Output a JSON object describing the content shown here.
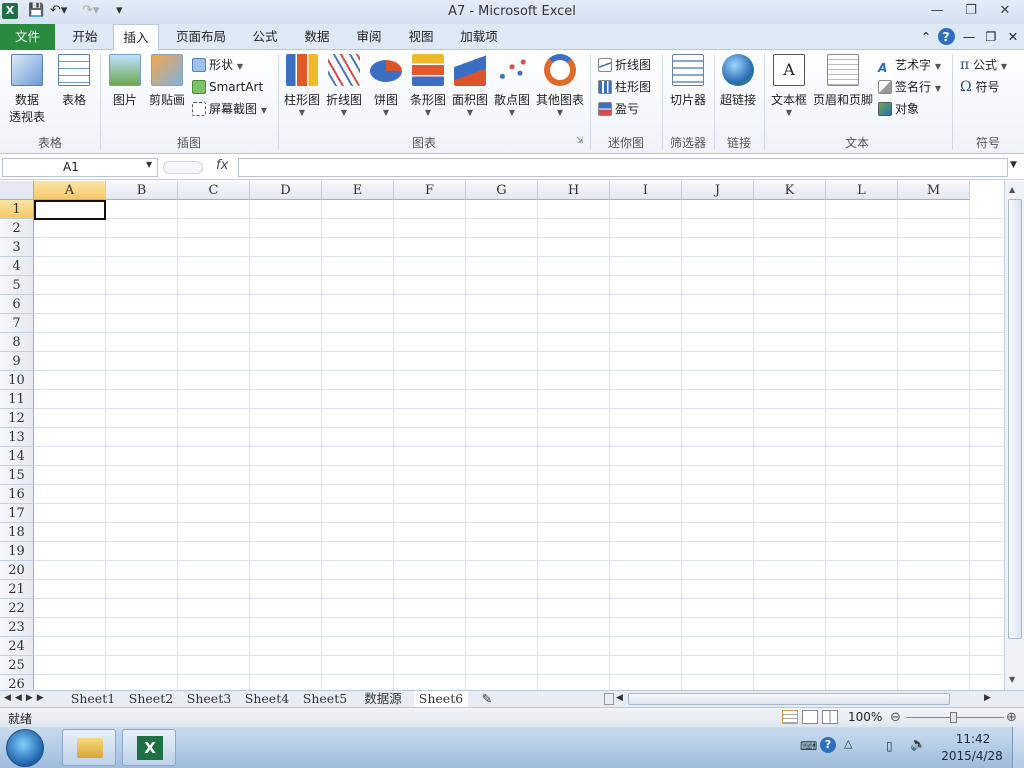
{
  "window": {
    "title": "A7  -  Microsoft Excel"
  },
  "tabs": [
    "文件",
    "开始",
    "插入",
    "页面布局",
    "公式",
    "数据",
    "审阅",
    "视图",
    "加载项"
  ],
  "active_tab": "插入",
  "ribbon": {
    "tables": {
      "pivot_label_1": "数据",
      "pivot_label_2": "透视表",
      "table_label": "表格",
      "group": "表格"
    },
    "illustrations": {
      "picture": "图片",
      "clipart": "剪贴画",
      "shapes": "形状",
      "smartart": "SmartArt",
      "screenshot": "屏幕截图",
      "group": "插图"
    },
    "charts": {
      "column": "柱形图",
      "line": "折线图",
      "pie": "饼图",
      "bar": "条形图",
      "area": "面积图",
      "scatter": "散点图",
      "other": "其他图表",
      "group": "图表"
    },
    "sparklines": {
      "line": "折线图",
      "column": "柱形图",
      "winloss": "盈亏",
      "group": "迷你图"
    },
    "filter": {
      "slicer": "切片器",
      "group": "筛选器"
    },
    "links": {
      "hyperlink": "超链接",
      "group": "链接"
    },
    "text": {
      "textbox": "文本框",
      "header_footer": "页眉和页脚",
      "wordart": "艺术字",
      "signature": "签名行",
      "object": "对象",
      "group": "文本"
    },
    "symbols": {
      "equation": "公式",
      "symbol": "符号",
      "group": "符号"
    }
  },
  "formula_bar": {
    "name_box": "A1",
    "fx": "fx",
    "value": ""
  },
  "columns": [
    "A",
    "B",
    "C",
    "D",
    "E",
    "F",
    "G",
    "H",
    "I",
    "J",
    "K",
    "L",
    "M"
  ],
  "rows": [
    "1",
    "2",
    "3",
    "4",
    "5",
    "6",
    "7",
    "8",
    "9",
    "10",
    "11",
    "12",
    "13",
    "14",
    "15",
    "16",
    "17",
    "18",
    "19",
    "20",
    "21",
    "22",
    "23",
    "24",
    "25",
    "26"
  ],
  "sheets": [
    "Sheet1",
    "Sheet2",
    "Sheet3",
    "Sheet4",
    "Sheet5",
    "数据源",
    "Sheet6"
  ],
  "active_sheet": "Sheet6",
  "status": {
    "ready": "就绪",
    "zoom": "100%"
  },
  "taskbar": {
    "time": "11:42",
    "date": "2015/4/28"
  }
}
